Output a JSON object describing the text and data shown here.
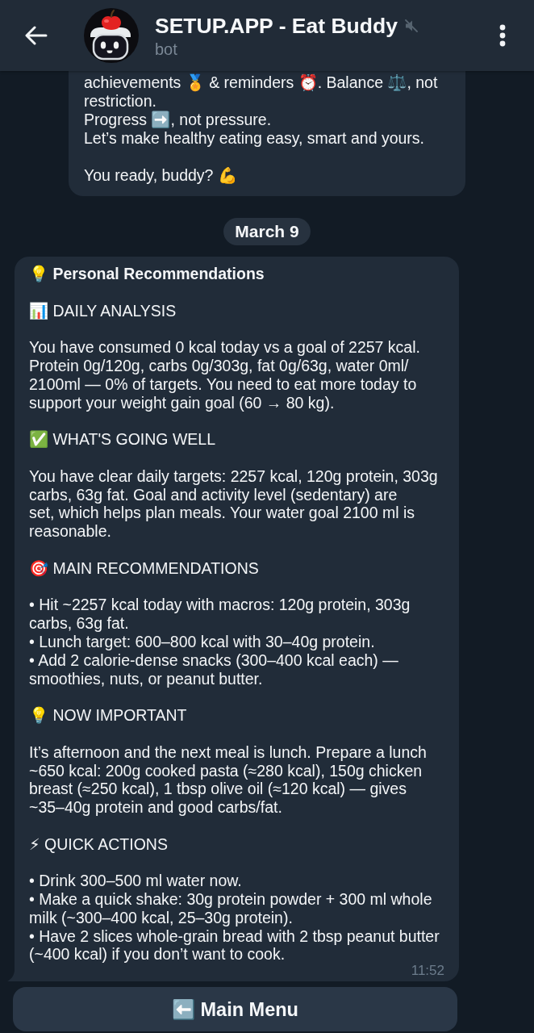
{
  "header": {
    "title": "SETUP.APP - Eat Buddy",
    "subtitle": "bot",
    "muted": true
  },
  "chat": [
    {
      "kind": "message",
      "tail": false,
      "blocks": [
        {
          "kind": "paragraph",
          "text": "achievements 🏅 & reminders ⏰. Balance ⚖️, not\nrestriction.\nProgress ➡️, not pressure.\nLet’s make healthy eating easy, smart and yours."
        },
        {
          "kind": "paragraph",
          "text": "You ready, buddy? 💪"
        }
      ]
    },
    {
      "kind": "date",
      "text": "March 9"
    },
    {
      "kind": "message",
      "tail": true,
      "time": "11:52",
      "blocks": [
        {
          "kind": "title",
          "text": "💡 Personal Recommendations"
        },
        {
          "kind": "heading",
          "text": "📊 DAILY ANALYSIS"
        },
        {
          "kind": "paragraph",
          "text": "You have consumed 0 kcal today vs a goal of 2257 kcal.\nProtein 0g/120g, carbs 0g/303g, fat 0g/63g, water 0ml/\n2100ml — 0% of targets. You need to eat more today to\nsupport your weight gain goal (60 → 80 kg)."
        },
        {
          "kind": "heading",
          "text": "✅ WHAT'S GOING WELL"
        },
        {
          "kind": "paragraph",
          "text": "You have clear daily targets: 2257 kcal, 120g protein, 303g\ncarbs, 63g fat. Goal and activity level (sedentary) are\nset, which helps plan meals. Your water goal 2100 ml is\nreasonable."
        },
        {
          "kind": "heading",
          "text": "🎯 MAIN RECOMMENDATIONS"
        },
        {
          "kind": "bullets",
          "items": [
            "• Hit ~2257 kcal today with macros: 120g protein, 303g\ncarbs, 63g fat.",
            "• Lunch target: 600–800 kcal with 30–40g protein.",
            "• Add 2 calorie-dense snacks (300–400 kcal each) —\nsmoothies, nuts, or peanut butter."
          ]
        },
        {
          "kind": "heading",
          "text": "💡 NOW IMPORTANT"
        },
        {
          "kind": "paragraph",
          "text": "It’s afternoon and the next meal is lunch. Prepare a lunch\n~650 kcal: 200g cooked pasta (≈280 kcal), 150g chicken\nbreast (≈250 kcal), 1 tbsp olive oil (≈120 kcal) — gives\n~35–40g protein and good carbs/fat."
        },
        {
          "kind": "heading",
          "text": "⚡ QUICK ACTIONS"
        },
        {
          "kind": "bullets",
          "items": [
            "• Drink 300–500 ml water now.",
            "• Make a quick shake: 30g protein powder + 300 ml whole\nmilk (~300–400 kcal, 25–30g protein).",
            "• Have 2 slices whole-grain bread with 2 tbsp peanut butter\n(~400 kcal) if you don’t want to cook."
          ]
        }
      ]
    }
  ],
  "keyboard": {
    "buttons": [
      "⬅️ Main Menu"
    ]
  }
}
